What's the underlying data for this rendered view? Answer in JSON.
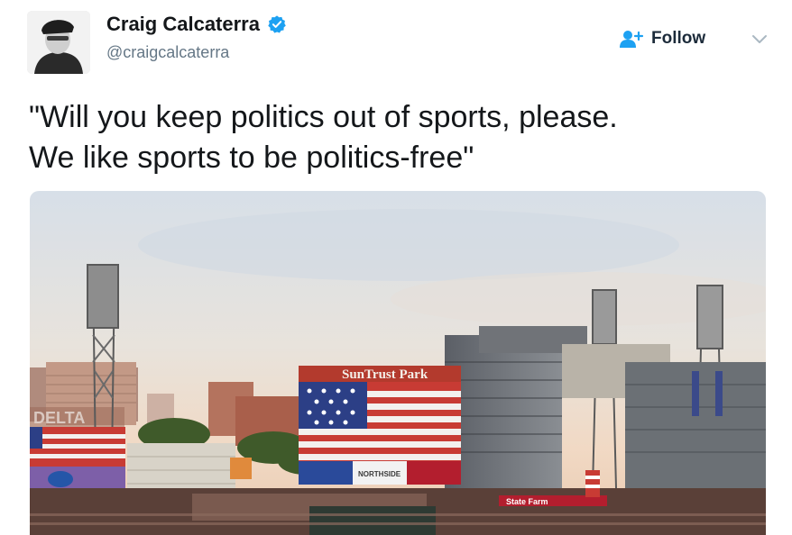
{
  "tweet": {
    "display_name": "Craig Calcaterra",
    "handle": "@craigcalcaterra",
    "follow_label": "Follow",
    "text_line1": "\"Will you keep politics out of sports, please.",
    "text_line2": "We like sports to be politics-free\""
  },
  "icons": {
    "avatar": "avatar",
    "verified": "verified-badge-icon",
    "follow": "follow-person-icon",
    "caret": "chevron-down-icon"
  },
  "photo": {
    "scoreboard_brand": "SunTrust Park",
    "left_board_brand": "DELTA",
    "sponsors": [
      "NORTHSIDE",
      "State Farm"
    ]
  },
  "colors": {
    "accent": "#1da1f2",
    "text": "#14171a",
    "secondary_text": "#657786"
  }
}
